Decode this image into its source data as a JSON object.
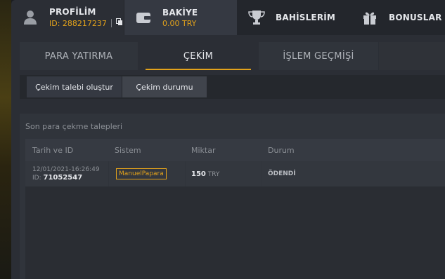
{
  "nav": {
    "profile": {
      "title": "PROFİLİM",
      "id": "ID: 288217237"
    },
    "balance": {
      "title": "BAKİYE",
      "amount": "0.00 TRY"
    },
    "bets": {
      "title": "BAHİSLERİM"
    },
    "bonus": {
      "title": "BONUSLAR"
    }
  },
  "tabs": {
    "deposit": "PARA YATIRMA",
    "withdraw": "ÇEKİM",
    "history": "İŞLEM GEÇMİŞİ"
  },
  "subtabs": {
    "create": "Çekim talebi oluştur",
    "status": "Çekim durumu"
  },
  "panel": {
    "title": "Son para çekme talepleri",
    "columns": [
      "Tarih ve ID",
      "Sistem",
      "Miktar",
      "Durum"
    ],
    "rows": [
      {
        "date": "12/01/2021-16:26:49",
        "id_label": "ID:",
        "id": "71052547",
        "system": "ManuelPapara",
        "amount": "150",
        "currency": "TRY",
        "status": "ÖDENDİ"
      }
    ]
  },
  "colors": {
    "accent": "#e2a21b",
    "background": "#2b2e35"
  },
  "icons": [
    "user-icon",
    "wallet-icon",
    "copy-icon",
    "trophy-icon",
    "gift-icon"
  ]
}
